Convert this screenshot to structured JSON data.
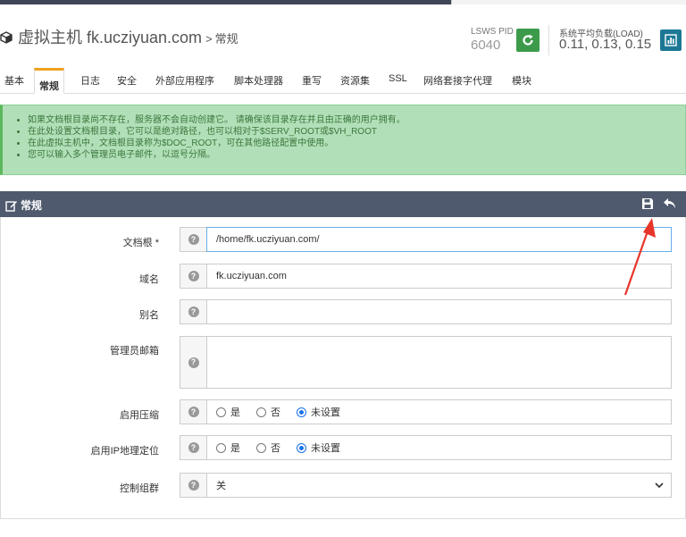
{
  "header": {
    "host": "虚拟主机 fk.ucziyuan.com",
    "crumb_sep": ">",
    "crumb": "常规",
    "pid_label": "LSWS PID",
    "pid_value": "6040",
    "load_label": "系统平均负载(LOAD)",
    "load_value": "0.11, 0.13, 0.15"
  },
  "tabs": [
    {
      "label": "基本"
    },
    {
      "label": "常规",
      "active": true
    },
    {
      "label": "日志"
    },
    {
      "label": "安全"
    },
    {
      "label": "外部应用程序"
    },
    {
      "label": "脚本处理器"
    },
    {
      "label": "重写"
    },
    {
      "label": "资源集"
    },
    {
      "label": "SSL"
    },
    {
      "label": "网络套接字代理"
    },
    {
      "label": "模块"
    }
  ],
  "notice": [
    "如果文档根目录尚不存在，服务器不会自动创建它。 请确保该目录存在并且由正确的用户拥有。",
    "在此处设置文档根目录，它可以是绝对路径，也可以相对于$SERV_ROOT或$VH_ROOT",
    "在此虚拟主机中，文档根目录称为$DOC_ROOT，可在其他路径配置中使用。",
    "您可以输入多个管理员电子邮件，以逗号分隔。"
  ],
  "panel": {
    "title": "常规"
  },
  "form": {
    "docroot_label": "文档根 *",
    "docroot_value": "/home/fk.ucziyuan.com/",
    "domain_label": "域名",
    "domain_value": "fk.ucziyuan.com",
    "alias_label": "别名",
    "alias_value": "",
    "admin_email_label": "管理员邮箱",
    "admin_email_value": "",
    "compress_label": "启用压缩",
    "geoip_label": "启用IP地理定位",
    "radio_yes": "是",
    "radio_no": "否",
    "radio_unset": "未设置",
    "cgroups_label": "控制组群",
    "cgroups_value": "关"
  },
  "help_glyph": "?",
  "colors": {
    "tab_accent": "#f0a020",
    "restart_btn": "#3c9b4a",
    "stats_btn": "#1d7896",
    "notice_bg": "#b1e0b8",
    "panel_header": "#505a6e",
    "annotation_arrow": "#e8352a"
  }
}
